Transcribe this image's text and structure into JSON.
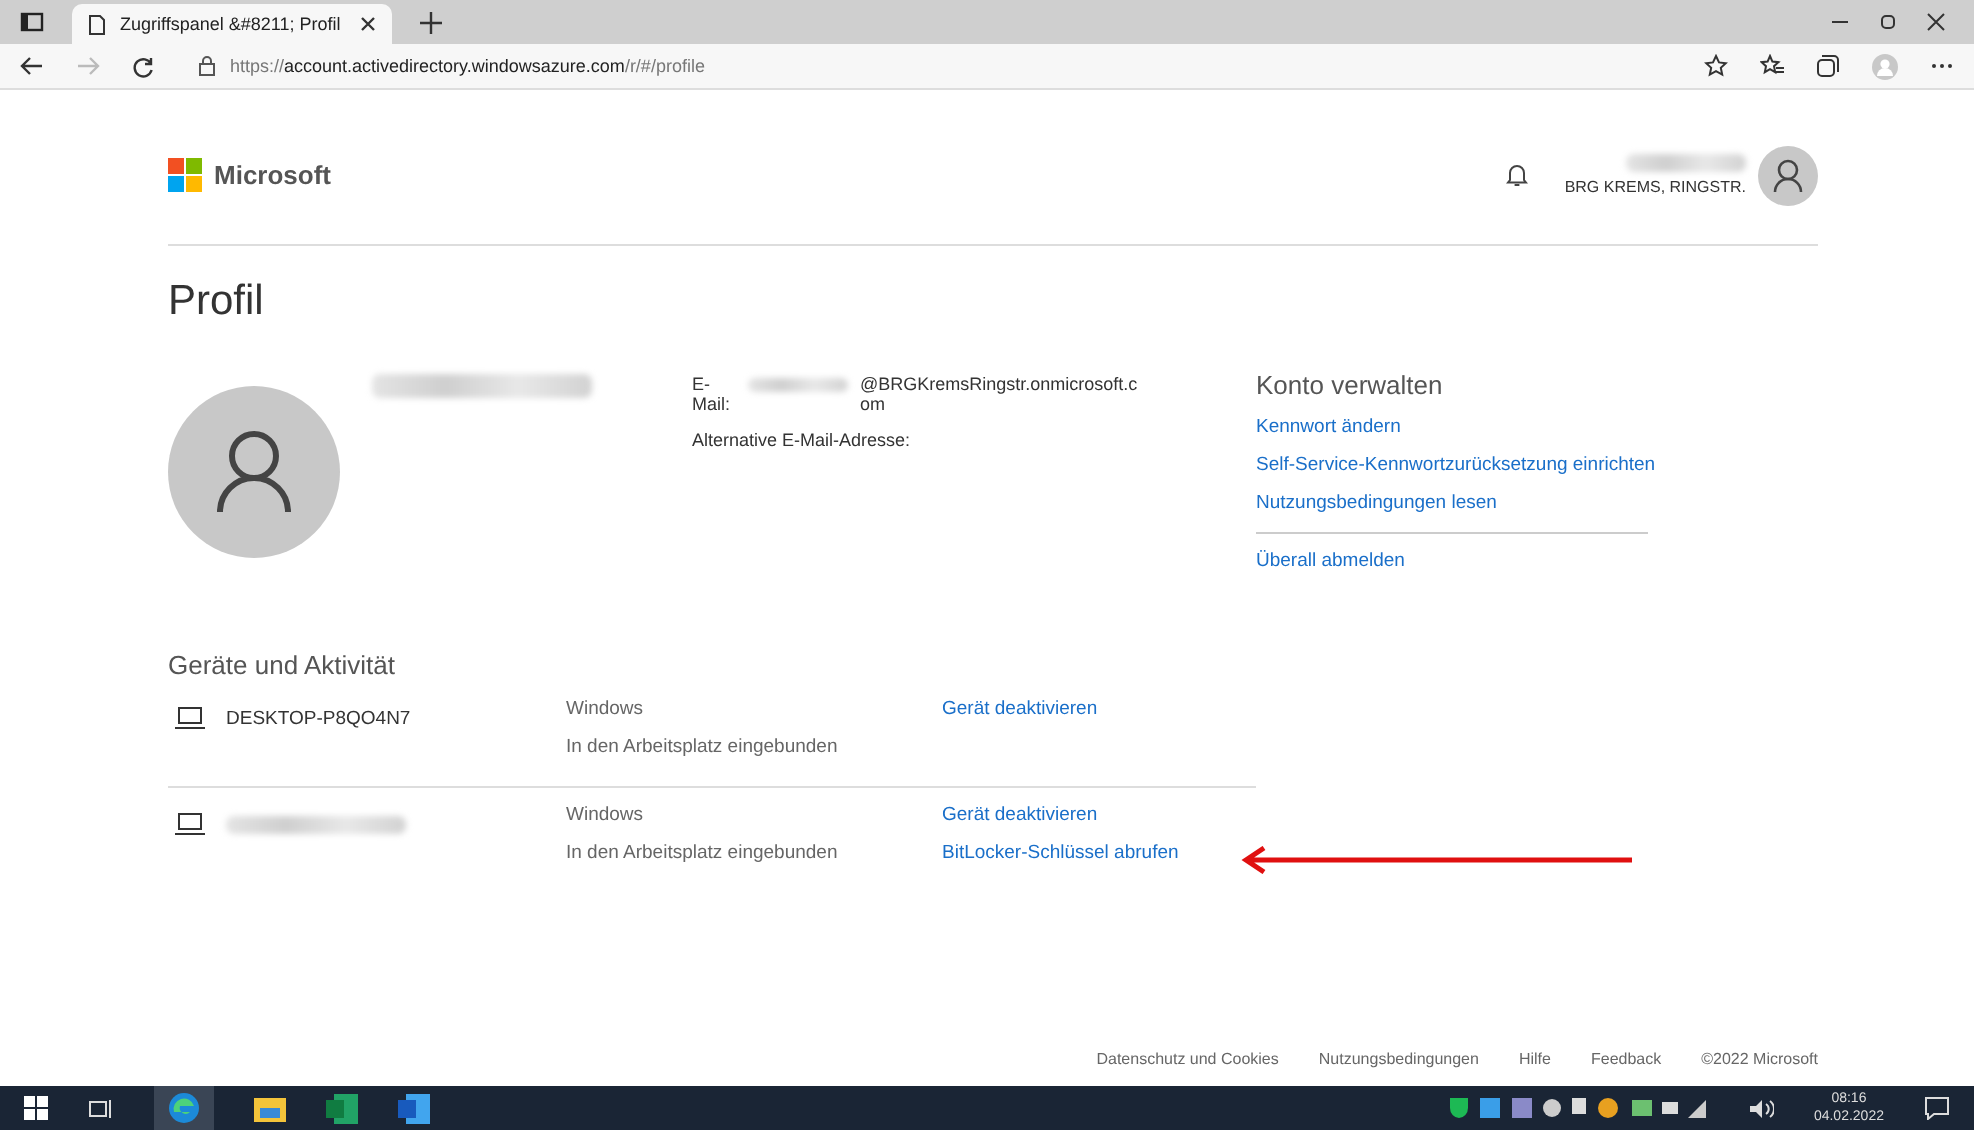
{
  "browser": {
    "tab_title": "Zugriffspanel &#8211; Profil",
    "url_prefix": "https://",
    "url_host": "account.activedirectory.windowsazure.com",
    "url_path": "/r/#/profile"
  },
  "header": {
    "brand": "Microsoft",
    "account_name": "BRG KREMS, RINGSTR."
  },
  "page_title": "Profil",
  "profile": {
    "email_label": "E-Mail:",
    "email": "@BRGKremsRingstr.onmicrosoft.com",
    "alt_email_label": "Alternative E-Mail-Adresse:"
  },
  "manage": {
    "title": "Konto verwalten",
    "links": [
      "Kennwort ändern",
      "Self-Service-Kennwortzurücksetzung einrichten",
      "Nutzungsbedingungen lesen"
    ],
    "signout": "Überall abmelden"
  },
  "devices": {
    "title": "Geräte und Aktivität",
    "items": [
      {
        "name": "DESKTOP-P8QO4N7",
        "os": "Windows",
        "status": "In den Arbeitsplatz eingebunden",
        "actions": [
          "Gerät deaktivieren"
        ]
      },
      {
        "os": "Windows",
        "status": "In den Arbeitsplatz eingebunden",
        "actions": [
          "Gerät deaktivieren",
          "BitLocker-Schlüssel abrufen"
        ]
      }
    ]
  },
  "footer": [
    "Datenschutz und Cookies",
    "Nutzungsbedingungen",
    "Hilfe",
    "Feedback",
    "©2022 Microsoft"
  ],
  "taskbar": {
    "time": "08:16",
    "date": "04.02.2022"
  }
}
